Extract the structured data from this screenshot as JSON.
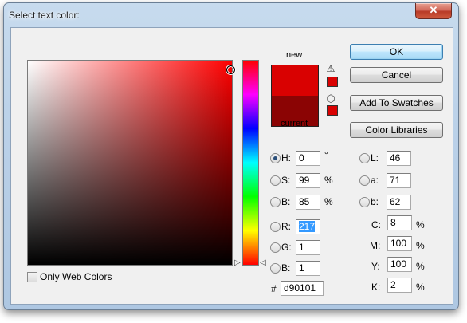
{
  "window": {
    "title": "Select text color:",
    "close_label": "✕"
  },
  "colors": {
    "new": "#d90101",
    "current": "#8b0404",
    "field_hue": "#ff0000"
  },
  "preview": {
    "new_label": "new",
    "current_label": "current"
  },
  "icons": {
    "gamut_warning": "warning-triangle-icon",
    "web_safe": "cube-icon"
  },
  "buttons": {
    "ok": "OK",
    "cancel": "Cancel",
    "add_to_swatches": "Add To Swatches",
    "color_libraries": "Color Libraries"
  },
  "hsb": {
    "h": {
      "label": "H:",
      "value": "0",
      "unit": "°",
      "selected": true
    },
    "s": {
      "label": "S:",
      "value": "99",
      "unit": "%"
    },
    "b": {
      "label": "B:",
      "value": "85",
      "unit": "%"
    }
  },
  "rgb": {
    "r": {
      "label": "R:",
      "value": "217"
    },
    "g": {
      "label": "G:",
      "value": "1"
    },
    "b": {
      "label": "B:",
      "value": "1"
    }
  },
  "lab": {
    "l": {
      "label": "L:",
      "value": "46"
    },
    "a": {
      "label": "a:",
      "value": "71"
    },
    "b": {
      "label": "b:",
      "value": "62"
    }
  },
  "cmyk": {
    "c": {
      "label": "C:",
      "value": "8",
      "unit": "%"
    },
    "m": {
      "label": "M:",
      "value": "100",
      "unit": "%"
    },
    "y": {
      "label": "Y:",
      "value": "100",
      "unit": "%"
    },
    "k": {
      "label": "K:",
      "value": "2",
      "unit": "%"
    }
  },
  "hex": {
    "label": "#",
    "value": "d90101"
  },
  "only_web_colors": {
    "label": "Only Web Colors",
    "checked": false
  }
}
